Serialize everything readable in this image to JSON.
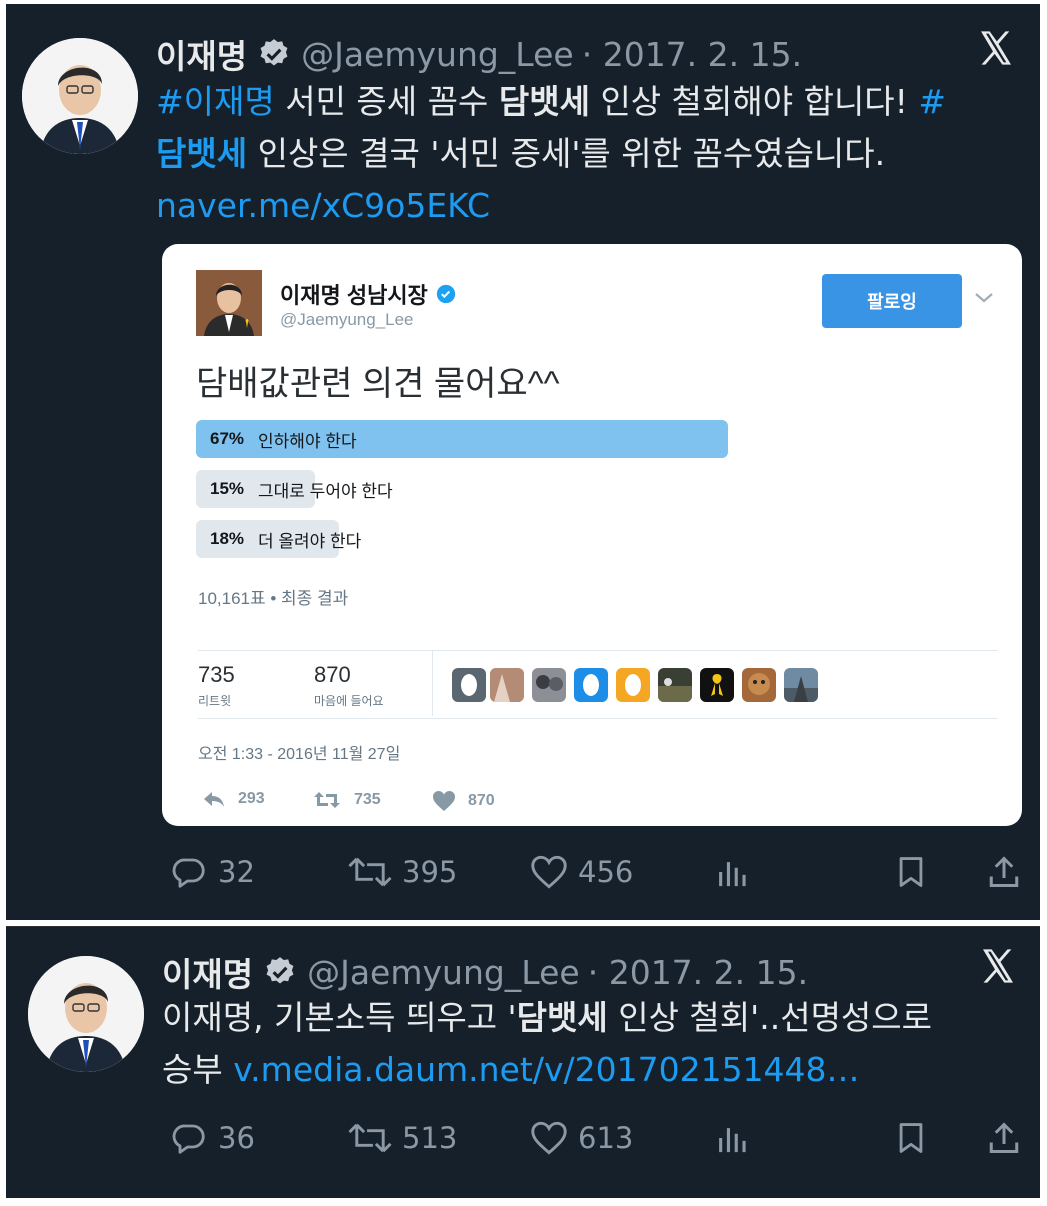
{
  "tweet1": {
    "author_name": "이재명",
    "handle": "@Jaemyung_Lee",
    "date": "· 2017. 2. 15.",
    "line1_hashtag": "#이재명",
    "line1_text_a": " 서민 증세 꼼수 ",
    "line1_bold": "담뱃세",
    "line1_text_b": " 인상 철회해야 합니다! ",
    "line1_hashtag2": "#",
    "line2_hashtag": "담뱃세",
    "line2_text": " 인상은 결국 '서민 증세'를 위한 꼼수였습니다.",
    "link": "naver.me/xC9o5EKC",
    "actions": {
      "reply": "32",
      "retweet": "395",
      "like": "456"
    }
  },
  "embedded": {
    "name": "이재명 성남시장",
    "handle": "@Jaemyung_Lee",
    "follow_label": "팔로잉",
    "text": "담배값관련 의견 물어요^^",
    "poll": [
      {
        "pct": "67%",
        "label": "인하해야 한다",
        "value": 0.67,
        "color": "#7fc1ef"
      },
      {
        "pct": "15%",
        "label": "그대로 두어야 한다",
        "value": 0.15,
        "color": "#e1e8ed"
      },
      {
        "pct": "18%",
        "label": "더 올려야 한다",
        "value": 0.18,
        "color": "#e1e8ed"
      }
    ],
    "poll_meta": "10,161표 • 최종 결과",
    "retweet_count": "735",
    "retweet_label": "리트윗",
    "like_count": "870",
    "like_label": "마음에 들어요",
    "timestamp": "오전 1:33 - 2016년 11월 27일",
    "footer": {
      "reply": "293",
      "retweet": "735",
      "like": "870"
    }
  },
  "tweet2": {
    "author_name": "이재명",
    "handle": "@Jaemyung_Lee",
    "date": "· 2017. 2. 15.",
    "line1_a": "이재명, 기본소득 띄우고 '",
    "line1_bold": "담뱃세",
    "line1_b": " 인상 철회'..선명성으로",
    "line2_a": "승부 ",
    "link": "v.media.daum.net/v/201702151448…",
    "actions": {
      "reply": "36",
      "retweet": "513",
      "like": "613"
    }
  }
}
